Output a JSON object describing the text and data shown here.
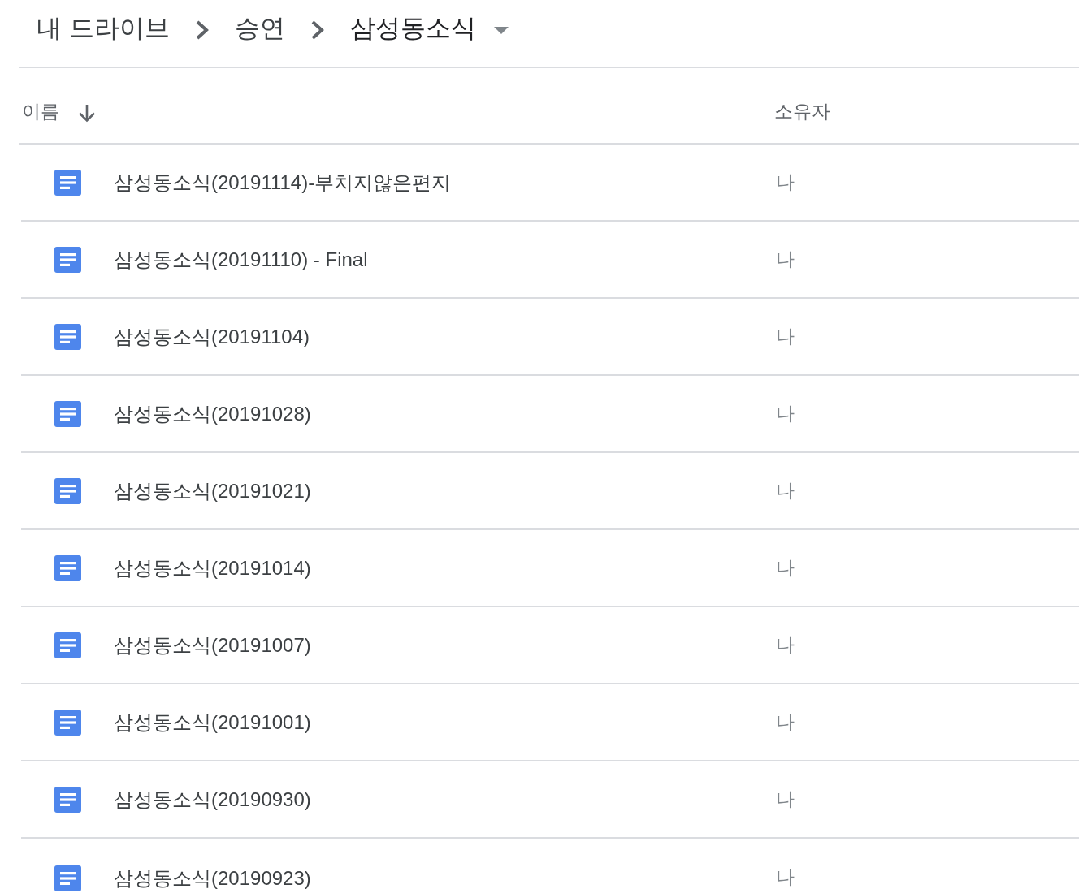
{
  "breadcrumb": [
    {
      "label": "내 드라이브",
      "current": false
    },
    {
      "label": "승연",
      "current": false
    },
    {
      "label": "삼성동소식",
      "current": true
    }
  ],
  "table": {
    "columns": [
      {
        "label": "이름",
        "sorted": true
      },
      {
        "label": "소유자",
        "sorted": false
      }
    ],
    "rows": [
      {
        "name": "삼성동소식(20191114)-부치지않은편지",
        "owner": "나"
      },
      {
        "name": "삼성동소식(20191110) - Final",
        "owner": "나"
      },
      {
        "name": "삼성동소식(20191104)",
        "owner": "나"
      },
      {
        "name": "삼성동소식(20191028)",
        "owner": "나"
      },
      {
        "name": "삼성동소식(20191021)",
        "owner": "나"
      },
      {
        "name": "삼성동소식(20191014)",
        "owner": "나"
      },
      {
        "name": "삼성동소식(20191007)",
        "owner": "나"
      },
      {
        "name": "삼성동소식(20191001)",
        "owner": "나"
      },
      {
        "name": "삼성동소식(20190930)",
        "owner": "나"
      },
      {
        "name": "삼성동소식(20190923)",
        "owner": "나"
      }
    ]
  }
}
